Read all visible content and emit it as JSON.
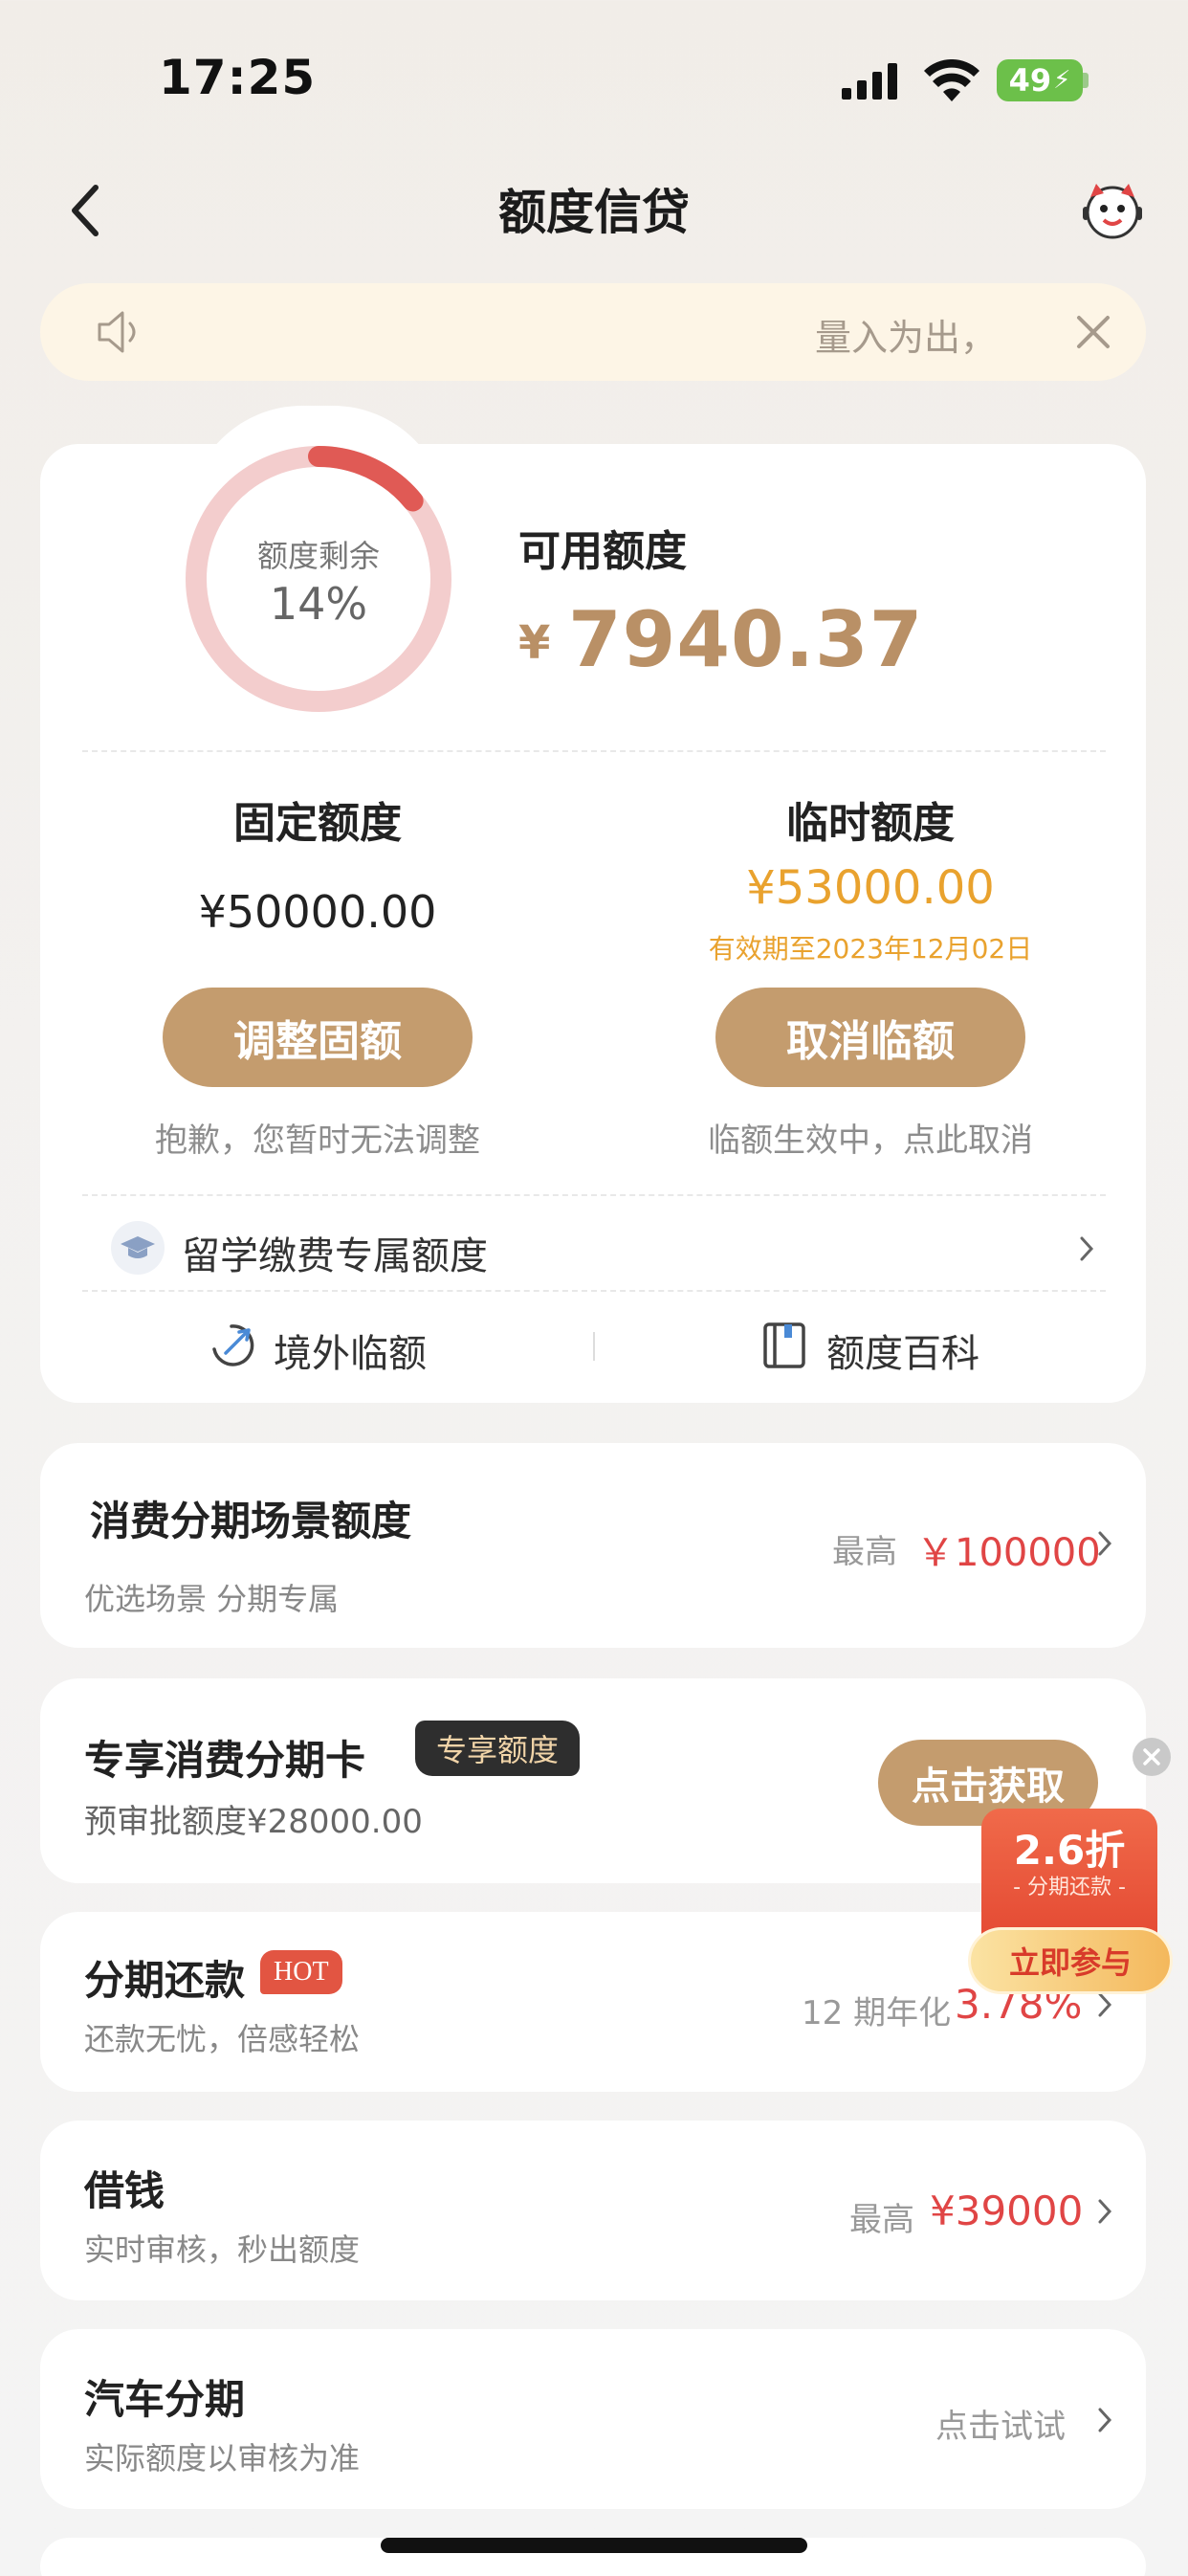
{
  "status_bar": {
    "time": "17:25",
    "battery": "49"
  },
  "nav": {
    "title": "额度信贷"
  },
  "notice": {
    "text": "量入为出，"
  },
  "credit": {
    "remaining_label": "额度剩余",
    "remaining_percent": "14%",
    "remaining_fraction": 0.14,
    "available_label": "可用额度",
    "currency": "¥",
    "available_amount": "7940.37",
    "fixed_title": "固定额度",
    "fixed_amount": "¥50000.00",
    "fixed_button": "调整固额",
    "fixed_hint": "抱歉，您暂时无法调整",
    "temp_title": "临时额度",
    "temp_amount": "¥53000.00",
    "temp_expiry": "有效期至2023年12月02日",
    "temp_button": "取消临额",
    "temp_hint": "临额生效中，点此取消",
    "study_label": "留学缴费专属额度",
    "overseas_label": "境外临额",
    "wiki_label": "额度百科"
  },
  "cards": {
    "installment_scene": {
      "title": "消费分期场景额度",
      "sub": "优选场景 分期专属",
      "right_label": "最高",
      "right_value": "￥100000"
    },
    "exclusive_card": {
      "title": "专享消费分期卡",
      "badge": "专享额度",
      "sub": "预审批额度¥28000.00",
      "button": "点击获取"
    },
    "repayment": {
      "title": "分期还款",
      "badge": "HOT",
      "sub": "还款无忧，倍感轻松",
      "right_label": "12 期年化",
      "right_value": "3.78%"
    },
    "borrow": {
      "title": "借钱",
      "sub": "实时审核，秒出额度",
      "right_label": "最高",
      "right_value": "¥39000"
    },
    "car": {
      "title": "汽车分期",
      "sub": "实际额度以审核为准",
      "right_label": "点击试试"
    }
  },
  "promo": {
    "discount": "2.6折",
    "desc": "- 分期还款 -",
    "button": "立即参与"
  },
  "colors": {
    "gold": "#c49c6e",
    "amount_gold": "#b99066",
    "orange": "#e9a22e",
    "red": "#e04545",
    "ring_track": "#f3cdcd",
    "ring_fill": "#e05a55"
  }
}
